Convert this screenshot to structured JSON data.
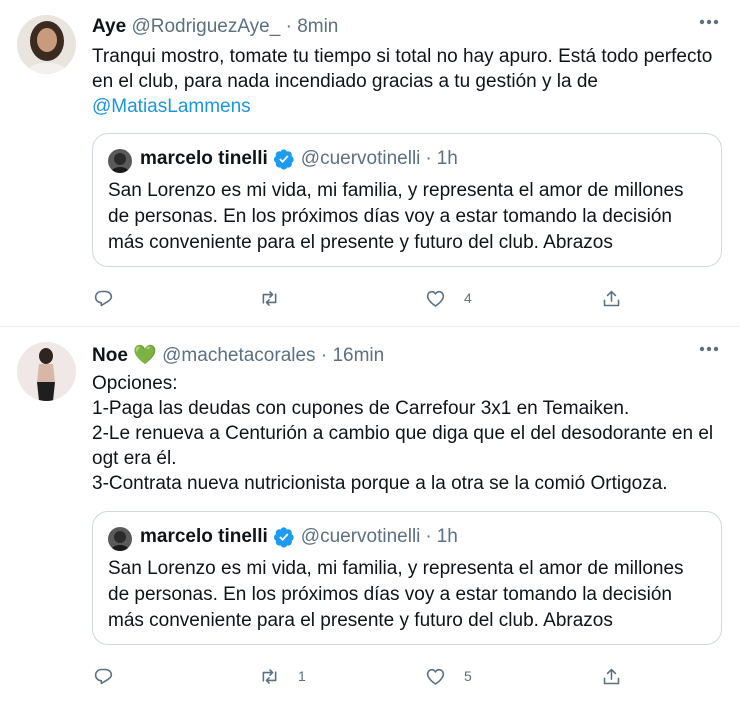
{
  "tweets": [
    {
      "name": "Aye",
      "handle": "@RodriguezAye_",
      "time": "8min",
      "text_before": "Tranqui mostro, tomate tu tiempo si total no hay apuro. Está todo perfecto en el club, para nada incendiado gracias a tu gestión y la de ",
      "mention": "@MatiasLammens",
      "quote": {
        "name": "marcelo tinelli",
        "handle": "@cuervotinelli",
        "time": "1h",
        "text": "San Lorenzo es mi vida, mi familia,  y representa el amor de millones de personas. En los próximos días voy a estar tomando la decisión más conveniente para el presente y futuro del club. Abrazos"
      },
      "actions": {
        "reply": "",
        "retweet": "",
        "like": "4",
        "share": ""
      }
    },
    {
      "name": "Noe",
      "emoji": "💚",
      "handle": "@machetacorales",
      "time": "16min",
      "text": "Opciones:\n1-Paga las deudas con cupones de Carrefour 3x1 en Temaiken.\n2-Le renueva a Centurión a cambio que diga que el del desodorante en el ogt era él.\n3-Contrata nueva nutricionista porque a la otra se la comió Ortigoza.",
      "quote": {
        "name": "marcelo tinelli",
        "handle": "@cuervotinelli",
        "time": "1h",
        "text": "San Lorenzo es mi vida, mi familia,  y representa el amor de millones de personas. En los próximos días voy a estar tomando la decisión más conveniente para el presente y futuro del club. Abrazos"
      },
      "actions": {
        "reply": "",
        "retweet": "1",
        "like": "5",
        "share": ""
      }
    }
  ],
  "ui": {
    "separator": "·",
    "accent": "#1b95e0",
    "muted": "#5b7083",
    "verified_color": "#1d9bf0"
  }
}
